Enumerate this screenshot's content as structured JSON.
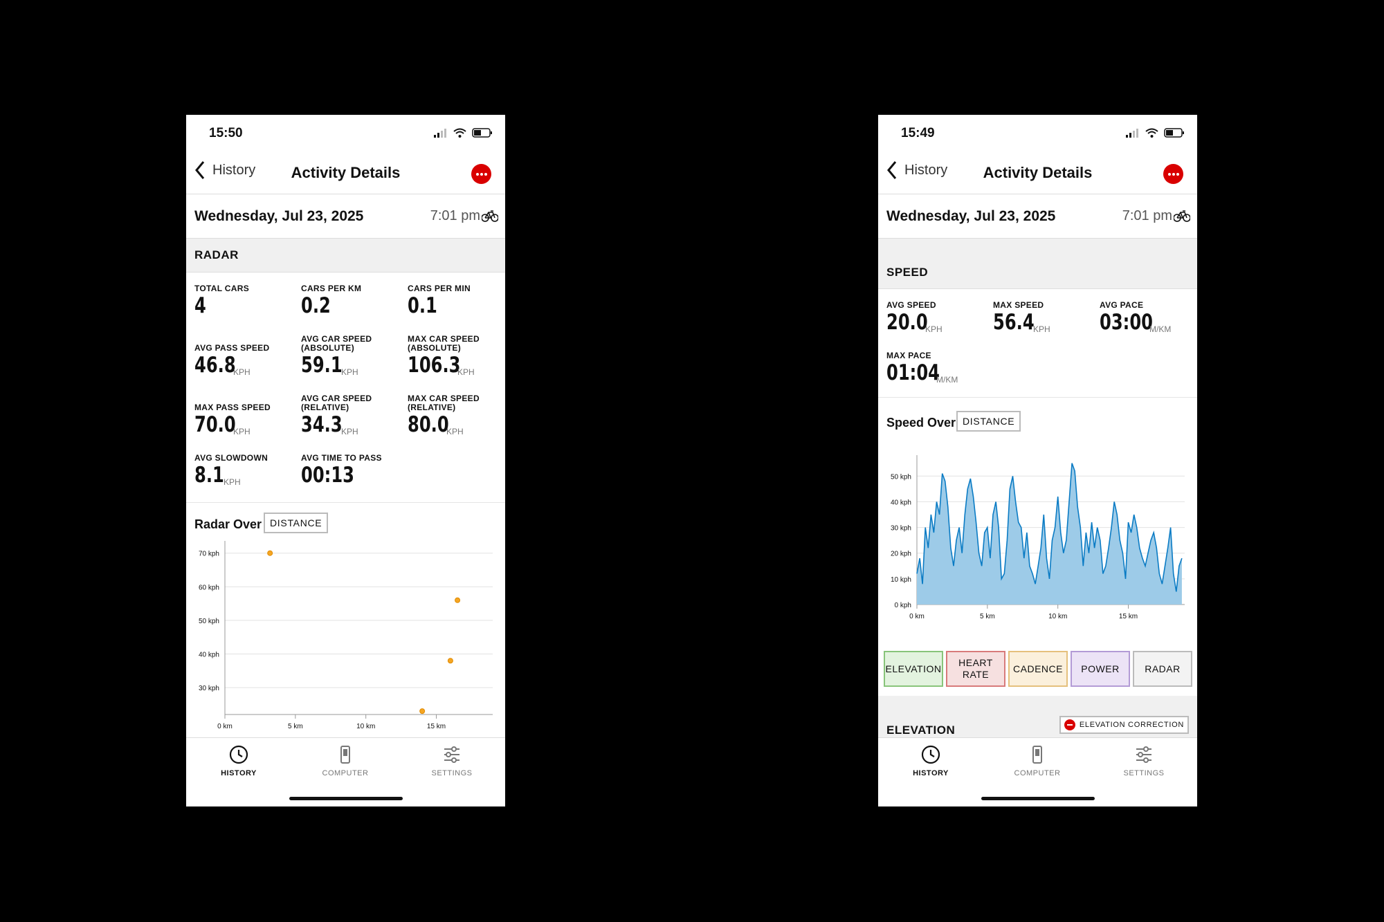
{
  "left_screen": {
    "time": "15:50",
    "nav": {
      "back_label": "History",
      "title": "Activity Details"
    },
    "date": "Wednesday, Jul 23, 2025",
    "time_of_day": "7:01 pm",
    "section_title": "RADAR",
    "stats": [
      {
        "label": "TOTAL CARS",
        "value": "4",
        "unit": ""
      },
      {
        "label": "CARS PER KM",
        "value": "0.2",
        "unit": ""
      },
      {
        "label": "CARS PER MIN",
        "value": "0.1",
        "unit": ""
      },
      {
        "label": "AVG PASS SPEED",
        "value": "46.8",
        "unit": "KPH"
      },
      {
        "label": "AVG CAR SPEED (ABSOLUTE)",
        "value": "59.1",
        "unit": "KPH"
      },
      {
        "label": "MAX CAR SPEED (ABSOLUTE)",
        "value": "106.3",
        "unit": "KPH"
      },
      {
        "label": "MAX PASS SPEED",
        "value": "70.0",
        "unit": "KPH"
      },
      {
        "label": "AVG CAR SPEED (RELATIVE)",
        "value": "34.3",
        "unit": "KPH"
      },
      {
        "label": "MAX CAR SPEED (RELATIVE)",
        "value": "80.0",
        "unit": "KPH"
      },
      {
        "label": "AVG SLOWDOWN",
        "value": "8.1",
        "unit": "KPH"
      },
      {
        "label": "AVG TIME TO PASS",
        "value": "00:13",
        "unit": ""
      }
    ],
    "chart_heading": "Radar Over",
    "chart_mode": "DISTANCE",
    "tabs": [
      "HISTORY",
      "COMPUTER",
      "SETTINGS"
    ]
  },
  "right_screen": {
    "time": "15:49",
    "nav": {
      "back_label": "History",
      "title": "Activity Details"
    },
    "date": "Wednesday, Jul 23, 2025",
    "time_of_day": "7:01 pm",
    "section_title": "SPEED",
    "stats": [
      {
        "label": "AVG SPEED",
        "value": "20.0",
        "unit": "KPH"
      },
      {
        "label": "MAX SPEED",
        "value": "56.4",
        "unit": "KPH"
      },
      {
        "label": "AVG PACE",
        "value": "03:00",
        "unit": "M/KM"
      },
      {
        "label": "MAX PACE",
        "value": "01:04",
        "unit": "M/KM"
      }
    ],
    "chart_heading": "Speed Over",
    "chart_mode": "DISTANCE",
    "metric_buttons": [
      {
        "label": "ELEVATION",
        "bg": "#e3f3df",
        "border": "#88c47a"
      },
      {
        "label": "HEART RATE",
        "bg": "#f6e0e0",
        "border": "#d87a7a"
      },
      {
        "label": "CADENCE",
        "bg": "#fbf0dc",
        "border": "#e5c07c"
      },
      {
        "label": "POWER",
        "bg": "#ece3f6",
        "border": "#b39bd6"
      },
      {
        "label": "RADAR",
        "bg": "#f3f3f3",
        "border": "#bbbbbb"
      }
    ],
    "elevation_title": "ELEVATION",
    "elevation_correction": "ELEVATION CORRECTION",
    "tabs": [
      "HISTORY",
      "COMPUTER",
      "SETTINGS"
    ]
  },
  "colors": {
    "accent_red": "#d90000",
    "speed_fill": "#9dcbe8",
    "speed_line": "#0a7bc4",
    "radar_point": "#f5a623"
  },
  "chart_data": [
    {
      "type": "scatter",
      "title": "Radar Over",
      "y_tick_labels": [
        "30 kph",
        "40 kph",
        "50 kph",
        "60 kph",
        "70 kph"
      ],
      "x_tick_labels": [
        "0 km",
        "5 km",
        "10 km",
        "15 km"
      ],
      "x_ticks": [
        0,
        5,
        10,
        15
      ],
      "y_ticks": [
        30,
        40,
        50,
        60,
        70
      ],
      "xlim": [
        0,
        19
      ],
      "ylim": [
        22,
        72
      ],
      "grid": true,
      "points": [
        {
          "x": 3.2,
          "y": 70.0
        },
        {
          "x": 16.5,
          "y": 56.0
        },
        {
          "x": 16.0,
          "y": 38.0
        },
        {
          "x": 14.0,
          "y": 23.0
        }
      ]
    },
    {
      "type": "area",
      "title": "Speed Over",
      "y_tick_labels": [
        "0 kph",
        "10 kph",
        "20 kph",
        "30 kph",
        "40 kph",
        "50 kph"
      ],
      "x_tick_labels": [
        "0 km",
        "5 km",
        "10 km",
        "15 km"
      ],
      "x_ticks": [
        0,
        5,
        10,
        15
      ],
      "y_ticks": [
        0,
        10,
        20,
        30,
        40,
        50
      ],
      "xlim": [
        0,
        19
      ],
      "ylim": [
        0,
        56
      ],
      "grid": true,
      "x": [
        0,
        0.2,
        0.4,
        0.6,
        0.8,
        1.0,
        1.2,
        1.4,
        1.6,
        1.8,
        2.0,
        2.2,
        2.4,
        2.6,
        2.8,
        3.0,
        3.2,
        3.4,
        3.6,
        3.8,
        4.0,
        4.2,
        4.4,
        4.6,
        4.8,
        5.0,
        5.2,
        5.4,
        5.6,
        5.8,
        6.0,
        6.2,
        6.4,
        6.6,
        6.8,
        7.0,
        7.2,
        7.4,
        7.6,
        7.8,
        8.0,
        8.2,
        8.4,
        8.6,
        8.8,
        9.0,
        9.2,
        9.4,
        9.6,
        9.8,
        10.0,
        10.2,
        10.4,
        10.6,
        10.8,
        11.0,
        11.2,
        11.4,
        11.6,
        11.8,
        12.0,
        12.2,
        12.4,
        12.6,
        12.8,
        13.0,
        13.2,
        13.4,
        13.6,
        13.8,
        14.0,
        14.2,
        14.4,
        14.6,
        14.8,
        15.0,
        15.2,
        15.4,
        15.6,
        15.8,
        16.0,
        16.2,
        16.4,
        16.6,
        16.8,
        17.0,
        17.2,
        17.4,
        17.6,
        17.8,
        18.0,
        18.2,
        18.4,
        18.6,
        18.8
      ],
      "values": [
        12,
        18,
        8,
        30,
        22,
        35,
        28,
        40,
        35,
        51,
        48,
        38,
        22,
        15,
        25,
        30,
        20,
        35,
        45,
        49,
        42,
        32,
        20,
        15,
        28,
        30,
        18,
        35,
        40,
        30,
        10,
        12,
        25,
        45,
        50,
        40,
        32,
        30,
        18,
        28,
        15,
        12,
        8,
        15,
        22,
        35,
        18,
        10,
        25,
        30,
        42,
        28,
        20,
        25,
        40,
        55,
        52,
        38,
        30,
        15,
        28,
        20,
        32,
        22,
        30,
        25,
        12,
        15,
        22,
        30,
        40,
        35,
        25,
        20,
        10,
        32,
        28,
        35,
        30,
        22,
        18,
        15,
        20,
        25,
        28,
        22,
        12,
        8,
        15,
        22,
        30,
        12,
        5,
        15,
        18
      ]
    }
  ]
}
